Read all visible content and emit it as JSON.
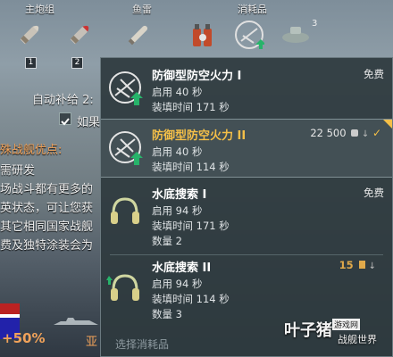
{
  "slots": {
    "main_battery": "主炮组",
    "torpedo": "鱼雷",
    "consumables": "消耗品",
    "key1": "1",
    "key2": "2",
    "count3": "3"
  },
  "left": {
    "auto_supply": "自动补给",
    "auto_supply_num": "2:",
    "checkbox_label": "如果",
    "section_title": "殊战舰优点:",
    "lines": [
      "需研发",
      "场战斗都有更多的",
      "英状态，可让您获",
      "其它相同国家战舰",
      "费及独特涂装会为"
    ],
    "bonus": "+50%",
    "bonus_right": "亚"
  },
  "panel": {
    "items": [
      {
        "name": "防御型防空火力 I",
        "line1": "启用 40 秒",
        "line2": "装填时间 171 秒",
        "line3": "",
        "price": "免费"
      },
      {
        "name": "防御型防空火力 II",
        "line1": "启用 40 秒",
        "line2": "装填时间 114 秒",
        "line3": "",
        "price": "22 500"
      },
      {
        "name": "水底搜索 I",
        "line1": "启用 94 秒",
        "line2": "装填时间 171 秒",
        "line3": "数量 2",
        "price": "免费"
      },
      {
        "name": "水底搜索 II",
        "line1": "启用 94 秒",
        "line2": "装填时间 114 秒",
        "line3": "数量 3",
        "price": "15"
      }
    ],
    "footer": "选择消耗品"
  },
  "watermark": {
    "brand": "叶子猪",
    "site": "游戏网",
    "sub": "战舰世界"
  },
  "colors": {
    "highlight": "#f4bf48",
    "green_arrow": "#27b36a",
    "gold": "#e0a94a"
  }
}
